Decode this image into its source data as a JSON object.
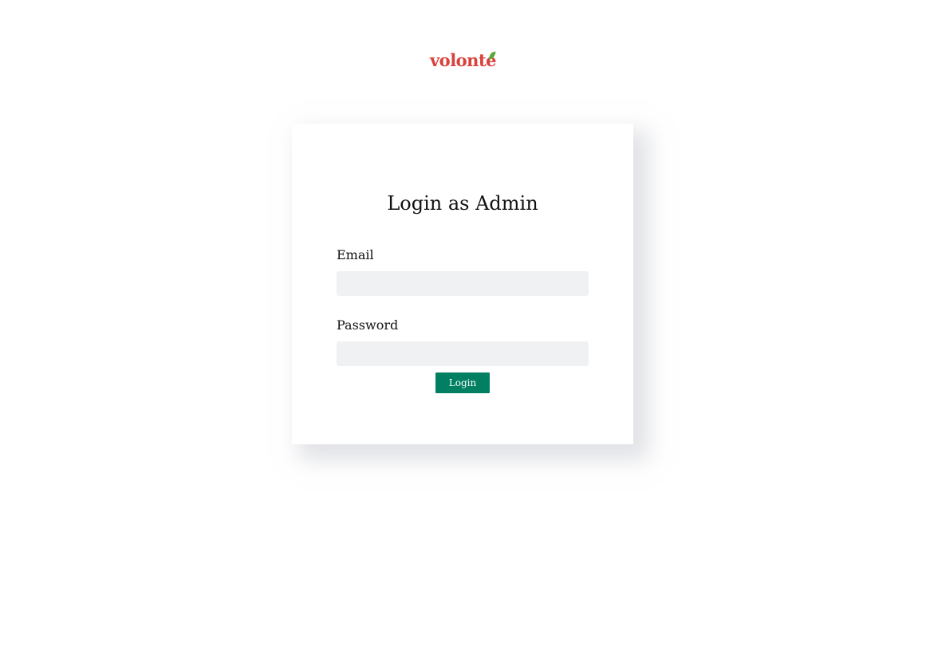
{
  "brand": {
    "logo_text": "volonté",
    "logo_color": "#d9413b",
    "leaf_color": "#5aa83c"
  },
  "login_form": {
    "title": "Login as Admin",
    "email_label": "Email",
    "email_value": "",
    "email_placeholder": "",
    "password_label": "Password",
    "password_value": "",
    "password_placeholder": "",
    "submit_label": "Login",
    "button_color": "#007f62",
    "input_background": "#f0f1f3"
  }
}
